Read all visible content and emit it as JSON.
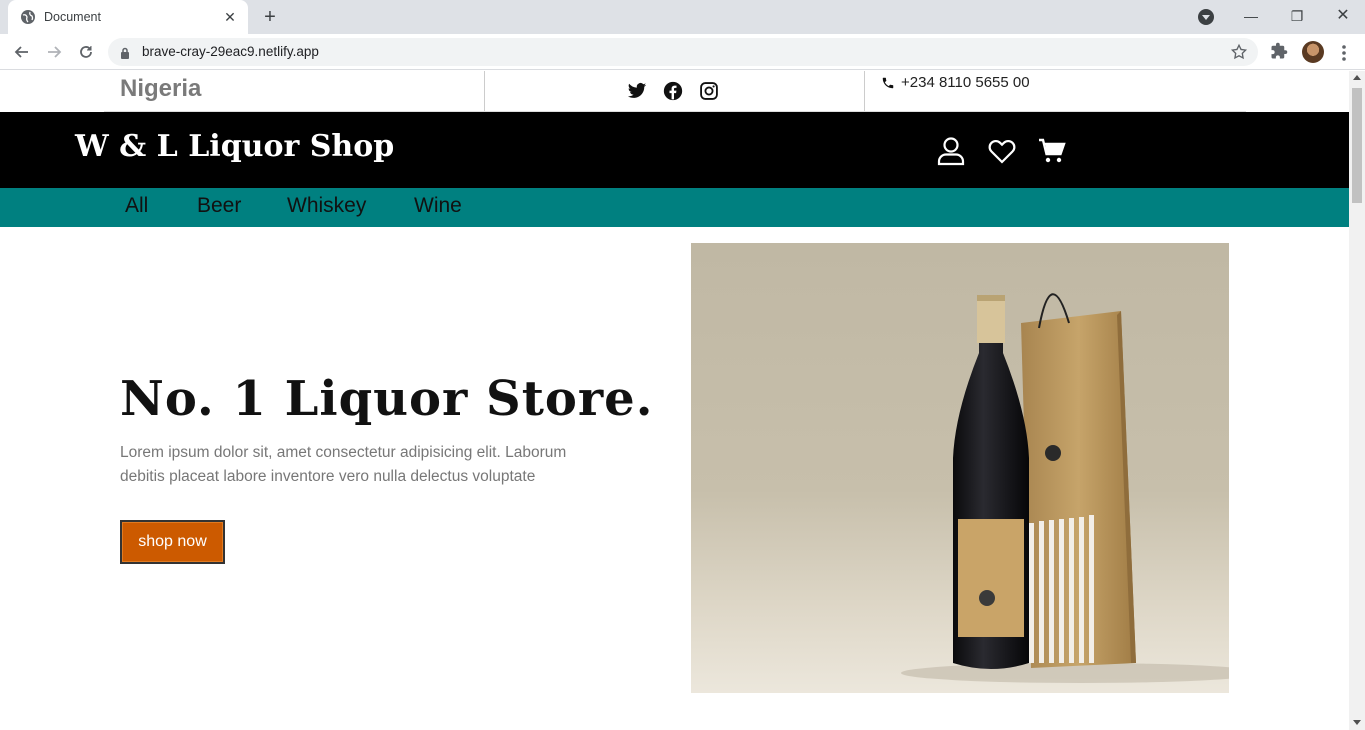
{
  "browser": {
    "tab_title": "Document",
    "url": "brave-cray-29eac9.netlify.app"
  },
  "topbar": {
    "country": "Nigeria",
    "phone": "+234 8110 5655 00",
    "socials": [
      "twitter-icon",
      "facebook-icon",
      "instagram-icon"
    ]
  },
  "header": {
    "brand": "W & L Liquor Shop",
    "icons": [
      "user-icon",
      "heart-icon",
      "cart-icon"
    ]
  },
  "nav": {
    "items": [
      {
        "label": "All"
      },
      {
        "label": "Beer"
      },
      {
        "label": "Whiskey"
      },
      {
        "label": "Wine"
      }
    ]
  },
  "hero": {
    "title": "No. 1 Liquor Store.",
    "text": "Lorem ipsum dolor sit, amet consectetur adipisicing elit. Laborum debitis placeat labore inventore vero nulla delectus voluptate",
    "button": "shop now"
  },
  "colors": {
    "header_bg": "#000000",
    "nav_bg": "#008080",
    "button_bg": "#cc5a00"
  }
}
